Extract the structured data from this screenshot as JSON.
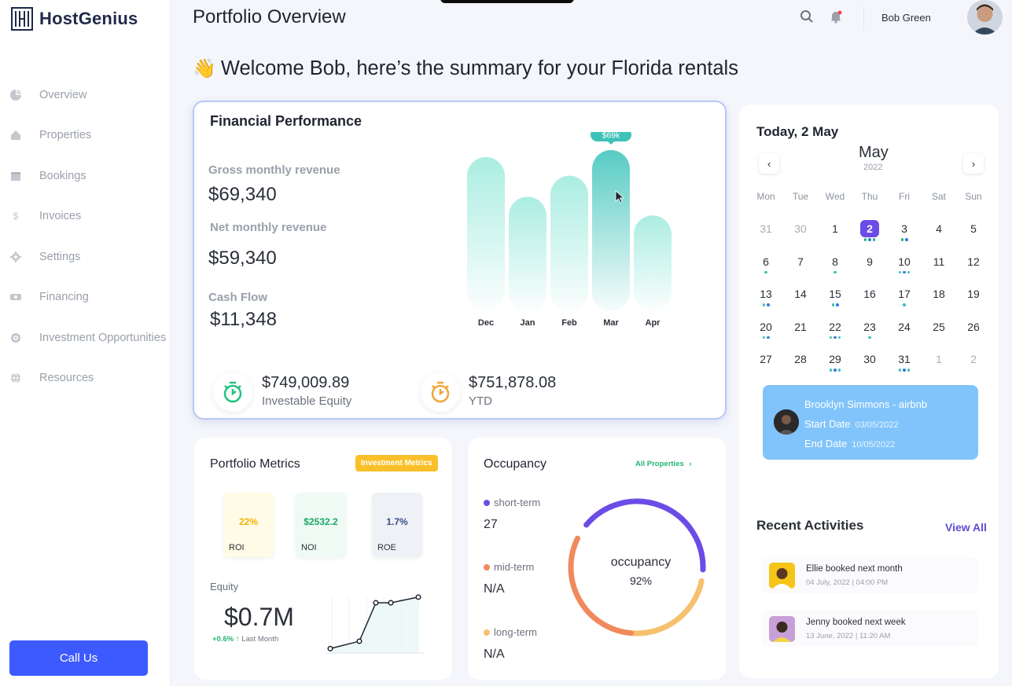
{
  "brand": {
    "name": "HostGenius"
  },
  "sidebar": {
    "items": [
      {
        "label": "Overview",
        "icon": "pie-chart-icon"
      },
      {
        "label": "Properties",
        "icon": "home-icon"
      },
      {
        "label": "Bookings",
        "icon": "calendar-icon"
      },
      {
        "label": "Invoices",
        "icon": "dollar-icon"
      },
      {
        "label": "Settings",
        "icon": "gear-icon"
      },
      {
        "label": "Financing",
        "icon": "money-icon"
      },
      {
        "label": "Investment Opportunities",
        "icon": "target-icon"
      },
      {
        "label": "Resources",
        "icon": "globe-icon"
      }
    ],
    "call_button": "Call Us"
  },
  "header": {
    "title": "Portfolio Overview",
    "user_name": "Bob Green"
  },
  "welcome": {
    "emoji": "👋",
    "text": "Welcome Bob, here’s the summary for your Florida rentals"
  },
  "financial": {
    "title": "Financial Performance",
    "gross_label": "Gross monthly revenue",
    "gross_value": "$69,340",
    "net_label": "Net monthly revenue",
    "net_value": "$59,340",
    "cash_label": "Cash Flow",
    "cash_value": "$11,348",
    "equity_value": "$749,009.89",
    "equity_label": "Investable Equity",
    "ytd_value": "$751,878.08",
    "ytd_label": "YTD"
  },
  "chart_data": {
    "type": "bar",
    "categories": [
      "Dec",
      "Jan",
      "Feb",
      "Mar",
      "Apr"
    ],
    "values": [
      66,
      49,
      58,
      69,
      41
    ],
    "highlight_index": 3,
    "tooltip": "$69k",
    "title": "",
    "xlabel": "",
    "ylabel": "",
    "colors": {
      "bar": "#a7ece0",
      "highlight": "#4ec9c0",
      "tooltip": "#3dc2b8"
    }
  },
  "calendar": {
    "today_label": "Today, 2 May",
    "month": "May",
    "year": "2022",
    "prev": "‹",
    "next": "›",
    "weekdays": [
      "Mon",
      "Tue",
      "Wed",
      "Thu",
      "Fri",
      "Sat",
      "Sun"
    ],
    "days": [
      {
        "d": "31",
        "muted": true,
        "dots": []
      },
      {
        "d": "30",
        "muted": true,
        "dots": []
      },
      {
        "d": "1",
        "dots": []
      },
      {
        "d": "2",
        "selected": true,
        "dots": [
          "#22b573",
          "#3d7be0",
          "#22b573"
        ]
      },
      {
        "d": "3",
        "dots": [
          "#22b573",
          "#3d7be0"
        ]
      },
      {
        "d": "4",
        "dots": []
      },
      {
        "d": "5",
        "dots": []
      },
      {
        "d": "6",
        "dots": [
          "#3dc2b8"
        ]
      },
      {
        "d": "7",
        "dots": []
      },
      {
        "d": "8",
        "dots": [
          "#3dc2b8"
        ]
      },
      {
        "d": "9",
        "dots": []
      },
      {
        "d": "10",
        "dots": [
          "#3dc2b8",
          "#3d7be0",
          "#3dc2b8"
        ]
      },
      {
        "d": "11",
        "dots": []
      },
      {
        "d": "12",
        "dots": []
      },
      {
        "d": "13",
        "dots": [
          "#3dc2b8",
          "#3d7be0"
        ]
      },
      {
        "d": "14",
        "dots": []
      },
      {
        "d": "15",
        "dots": [
          "#3dc2b8",
          "#3d7be0"
        ]
      },
      {
        "d": "16",
        "dots": []
      },
      {
        "d": "17",
        "dots": [
          "#3dc2b8"
        ]
      },
      {
        "d": "18",
        "dots": []
      },
      {
        "d": "19",
        "dots": []
      },
      {
        "d": "20",
        "dots": [
          "#3dc2b8",
          "#3d7be0"
        ]
      },
      {
        "d": "21",
        "dots": []
      },
      {
        "d": "22",
        "dots": [
          "#3dc2b8",
          "#3d7be0",
          "#3dc2b8"
        ]
      },
      {
        "d": "23",
        "dots": [
          "#3dc2b8"
        ]
      },
      {
        "d": "24",
        "dots": []
      },
      {
        "d": "25",
        "dots": []
      },
      {
        "d": "26",
        "dots": []
      },
      {
        "d": "27",
        "dots": []
      },
      {
        "d": "28",
        "dots": []
      },
      {
        "d": "29",
        "dots": [
          "#3dc2b8",
          "#3d7be0",
          "#3dc2b8"
        ]
      },
      {
        "d": "30",
        "dots": []
      },
      {
        "d": "31",
        "dots": [
          "#3dc2b8",
          "#3d7be0",
          "#3dc2b8"
        ]
      },
      {
        "d": "1",
        "muted": true,
        "dots": []
      },
      {
        "d": "2",
        "muted": true,
        "dots": []
      }
    ],
    "booking": {
      "name": "Brooklyn Simmons - airbnb",
      "start_label": "Start Date",
      "start_value": "03/05/2022",
      "end_label": "End Date",
      "end_value": "10/05/2022"
    }
  },
  "activities": {
    "title": "Recent Activities",
    "view_all": "View All",
    "items": [
      {
        "text": "Ellie booked next month",
        "time": "04 July, 2022 | 04:00 PM"
      },
      {
        "text": "Jenny booked next week",
        "time": "13 June, 2022 | 11:20 AM"
      }
    ]
  },
  "portfolio": {
    "title": "Portfolio Metrics",
    "badge": "Investment Metrics",
    "metrics": [
      {
        "value": "22%",
        "label": "ROI",
        "color": "#f0b400",
        "bg": "#fffbe6"
      },
      {
        "value": "$2532.2",
        "label": "NOI",
        "color": "#1ca66a",
        "bg": "#eefaf3"
      },
      {
        "value": "1.7%",
        "label": "ROE",
        "color": "#3b4a8c",
        "bg": "#eef1f6"
      }
    ],
    "equity_label": "Equity",
    "equity_value": "$0.7M",
    "equity_delta": "+0.6%",
    "equity_delta_label": "Last Month",
    "equity_trend": [
      0.05,
      0.18,
      0.86,
      0.86,
      0.96
    ]
  },
  "occupancy": {
    "title": "Occupancy",
    "all_link": "All Properties",
    "items": [
      {
        "label": "short-term",
        "value": "27",
        "color": "#6b4ce6"
      },
      {
        "label": "mid-term",
        "value": "N/A",
        "color": "#f08a5d"
      },
      {
        "label": "long-term",
        "value": "N/A",
        "color": "#f6c06d"
      }
    ],
    "center_label": "occupancy",
    "center_value": "92%",
    "percent": 92
  }
}
